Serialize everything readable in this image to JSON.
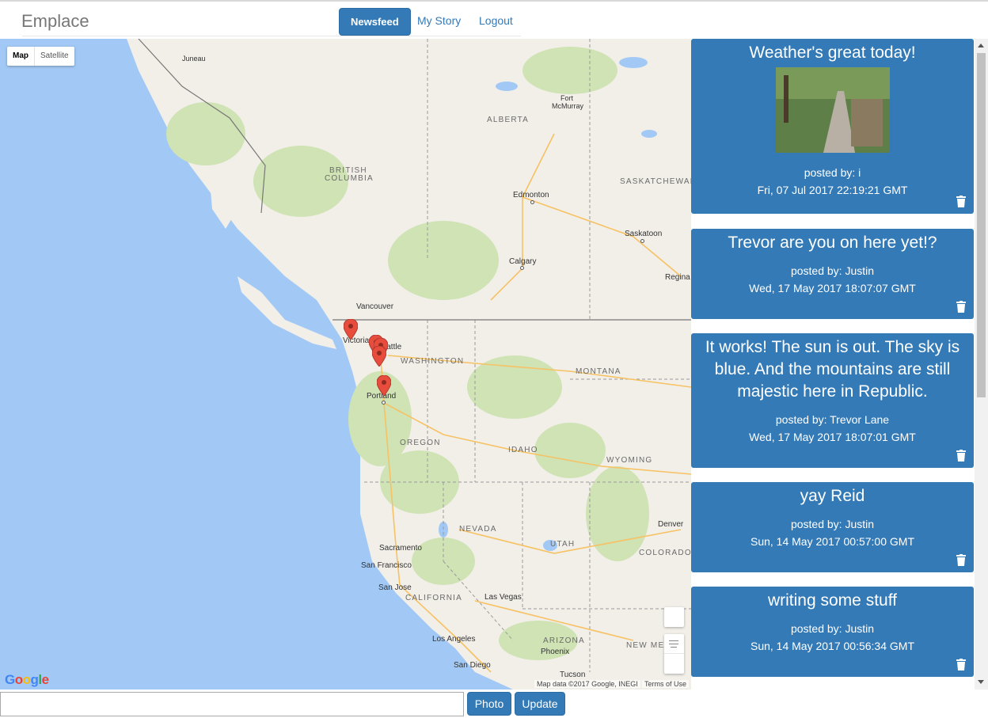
{
  "app": {
    "brand": "Emplace"
  },
  "nav": {
    "items": [
      {
        "label": "Newsfeed",
        "active": true
      },
      {
        "label": "My Story"
      },
      {
        "label": "Logout"
      }
    ]
  },
  "map": {
    "type_buttons": [
      "Map",
      "Satellite"
    ],
    "selected_type": "Map",
    "logo": "Google",
    "attribution": "Map data ©2017 Google, INEGI",
    "terms": "Terms of Use",
    "regions": {
      "alberta": "ALBERTA",
      "british_columbia_1": "BRITISH",
      "british_columbia_2": "COLUMBIA",
      "saskatchewan": "SASKATCHEWAN",
      "washington": "WASHINGTON",
      "montana": "MONTANA",
      "oregon": "OREGON",
      "idaho": "IDAHO",
      "wyoming": "WYOMING",
      "nevada": "NEVADA",
      "utah": "UTAH",
      "colorado": "COLORADO",
      "california": "CALIFORNIA",
      "arizona": "ARIZONA",
      "new_mexico": "NEW MEX"
    },
    "cities": {
      "juneau": "Juneau",
      "fort_mcmurray_1": "Fort",
      "fort_mcmurray_2": "McMurray",
      "edmonton": "Edmonton",
      "saskatoon": "Saskatoon",
      "calgary": "Calgary",
      "regina": "Regina",
      "vancouver": "Vancouver",
      "victoria": "Victoria",
      "seattle": "Seattle",
      "portland": "Portland",
      "denver": "Denver",
      "sacramento": "Sacramento",
      "san_francisco": "San Francisco",
      "san_jose": "San Jose",
      "las_vegas": "Las Vegas",
      "los_angeles": "Los Angeles",
      "phoenix": "Phoenix",
      "san_diego": "San Diego",
      "tucson": "Tucson"
    },
    "marker_count": 5
  },
  "feed": {
    "posts": [
      {
        "title": "Weather's great today!",
        "has_photo": true,
        "author": "posted by: i",
        "date": "Fri, 07 Jul 2017 22:19:21 GMT"
      },
      {
        "title": "Trevor are you on here yet!?",
        "author": "posted by: Justin",
        "date": "Wed, 17 May 2017 18:07:07 GMT"
      },
      {
        "title_lines": [
          "It works! The sun is out. The sky is",
          "blue. And the mountains are still",
          "majestic here in Republic."
        ],
        "author": "posted by: Trevor Lane",
        "date": "Wed, 17 May 2017 18:07:01 GMT"
      },
      {
        "title": "yay Reid",
        "author": "posted by: Justin",
        "date": "Sun, 14 May 2017 00:57:00 GMT"
      },
      {
        "title": "writing some stuff",
        "author": "posted by: Justin",
        "date": "Sun, 14 May 2017 00:56:34 GMT"
      }
    ]
  },
  "composer": {
    "input_value": "",
    "photo_label": "Photo",
    "update_label": "Update"
  },
  "colors": {
    "primary": "#337ab7",
    "ocean": "#a2c9f5",
    "land": "#f2efe9",
    "marker": "#e74c3c"
  }
}
